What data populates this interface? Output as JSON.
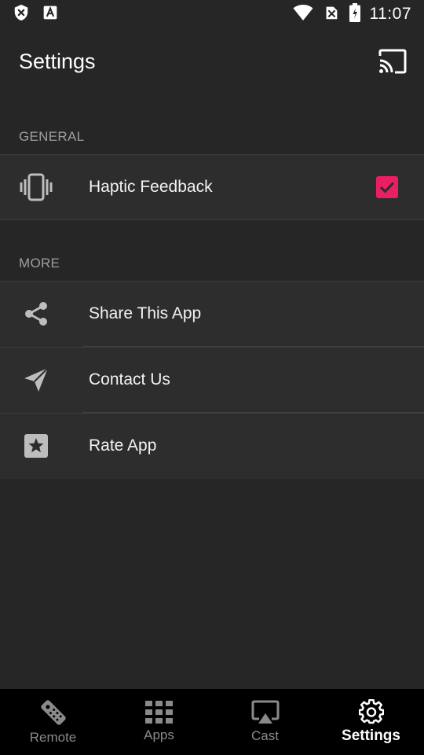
{
  "status_bar": {
    "time": "11:07",
    "left_icons": [
      "shield-x-icon",
      "font-a-icon"
    ],
    "right_icons": [
      "wifi-icon",
      "no-sim-icon",
      "battery-icon"
    ]
  },
  "app_bar": {
    "title": "Settings",
    "cast_icon": "cast-icon"
  },
  "sections": {
    "general": {
      "header": "GENERAL",
      "items": [
        {
          "label": "Haptic Feedback",
          "icon": "vibration-icon",
          "checked": true
        }
      ]
    },
    "more": {
      "header": "MORE",
      "items": [
        {
          "label": "Share This App",
          "icon": "share-icon"
        },
        {
          "label": "Contact Us",
          "icon": "send-icon"
        },
        {
          "label": "Rate App",
          "icon": "star-icon"
        }
      ]
    }
  },
  "bottom_nav": {
    "items": [
      {
        "label": "Remote",
        "icon": "remote-icon",
        "active": false
      },
      {
        "label": "Apps",
        "icon": "grid-icon",
        "active": false
      },
      {
        "label": "Cast",
        "icon": "airplay-icon",
        "active": false
      },
      {
        "label": "Settings",
        "icon": "gear-icon",
        "active": true
      }
    ]
  },
  "colors": {
    "background": "#262626",
    "row_background": "#2d2d2d",
    "accent": "#e91e63",
    "nav_background": "#000000",
    "section_header": "#9e9e9e"
  }
}
